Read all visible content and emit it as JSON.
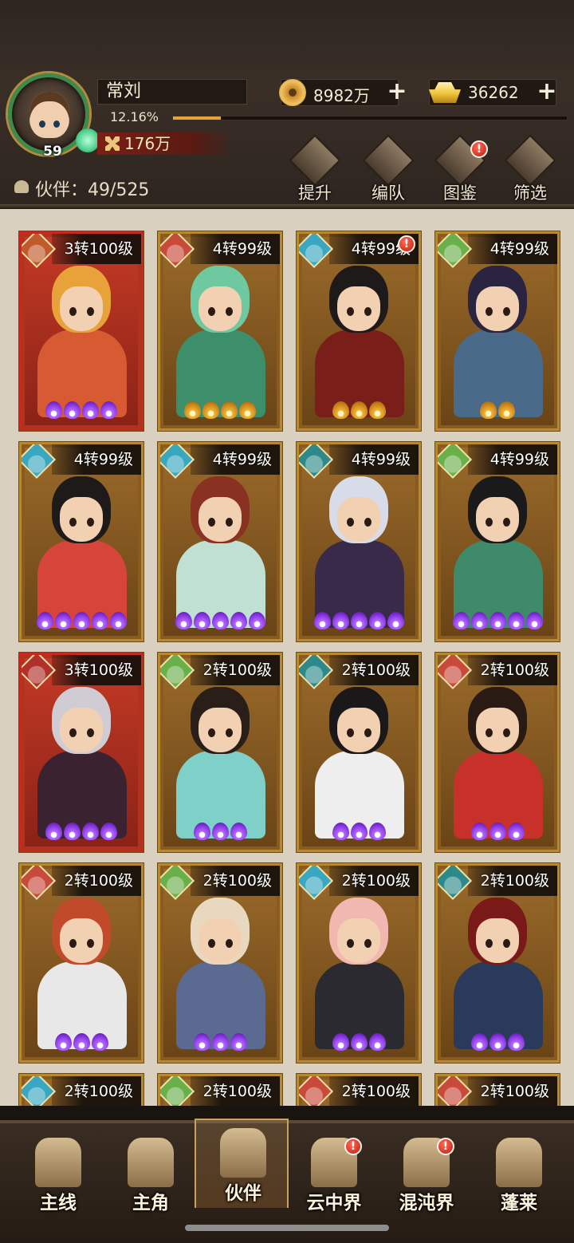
{
  "player": {
    "name": "常刘",
    "level": "59",
    "exp_percent": "12.16%",
    "exp_fraction": 0.1216,
    "power": "176万"
  },
  "currencies": {
    "coins": "8982万",
    "ingots": "36262"
  },
  "partner_count_label": "伙伴：49/525",
  "actions": [
    {
      "label": "提升",
      "icon": "upgrade-icon",
      "alert": false
    },
    {
      "label": "编队",
      "icon": "formation-icon",
      "alert": false
    },
    {
      "label": "图鉴",
      "icon": "codex-icon",
      "alert": true
    },
    {
      "label": "筛选",
      "icon": "filter-icon",
      "alert": false
    }
  ],
  "alert_mark": "!",
  "cards": [
    {
      "tag": "3转100级",
      "frame": "red",
      "element": "#c05a2a",
      "stars": 4,
      "star_color": "purple",
      "hair": "#e7a23a",
      "body": "#d85a32",
      "alert": false
    },
    {
      "tag": "4转99级",
      "frame": "gold",
      "element": "#c84a3a",
      "stars": 4,
      "star_color": "gold",
      "hair": "#6ec9a0",
      "body": "#3d8f6c",
      "alert": false
    },
    {
      "tag": "4转99级",
      "frame": "gold",
      "element": "#3aa7c0",
      "stars": 3,
      "star_color": "gold",
      "hair": "#1f1a1a",
      "body": "#7a1e1a",
      "alert": true
    },
    {
      "tag": "4转99级",
      "frame": "gold",
      "element": "#6ab04a",
      "stars": 2,
      "star_color": "gold",
      "hair": "#2a2440",
      "body": "#4a6a8a",
      "alert": false
    },
    {
      "tag": "4转99级",
      "frame": "gold",
      "element": "#3aa7c0",
      "stars": 5,
      "star_color": "purple",
      "hair": "#1e1a1a",
      "body": "#d6453a",
      "alert": false
    },
    {
      "tag": "4转99级",
      "frame": "gold",
      "element": "#3aa7c0",
      "stars": 5,
      "star_color": "purple",
      "hair": "#8a3222",
      "body": "#bfe0d2",
      "alert": false
    },
    {
      "tag": "4转99级",
      "frame": "gold",
      "element": "#2e8a8a",
      "stars": 5,
      "star_color": "purple",
      "hair": "#d8dce8",
      "body": "#3a2a4a",
      "alert": false
    },
    {
      "tag": "4转99级",
      "frame": "gold",
      "element": "#6ab04a",
      "stars": 5,
      "star_color": "purple",
      "hair": "#1a1a1a",
      "body": "#3f8a6a",
      "alert": false
    },
    {
      "tag": "3转100级",
      "frame": "red",
      "element": "#b0302a",
      "stars": 4,
      "star_color": "purple",
      "hair": "#d0ccd4",
      "body": "#3a2230",
      "alert": false
    },
    {
      "tag": "2转100级",
      "frame": "gold",
      "element": "#6ab04a",
      "stars": 3,
      "star_color": "purple",
      "hair": "#2a1e18",
      "body": "#7ed0c8",
      "alert": false
    },
    {
      "tag": "2转100级",
      "frame": "gold",
      "element": "#2e8a8a",
      "stars": 3,
      "star_color": "purple",
      "hair": "#1a1818",
      "body": "#eeeeee",
      "alert": false
    },
    {
      "tag": "2转100级",
      "frame": "gold",
      "element": "#c84a3a",
      "stars": 3,
      "star_color": "purple",
      "hair": "#2a1a14",
      "body": "#c8302a",
      "alert": false
    },
    {
      "tag": "2转100级",
      "frame": "gold",
      "element": "#c84a3a",
      "stars": 3,
      "star_color": "purple",
      "hair": "#c04a2a",
      "body": "#e8e8e8",
      "alert": false
    },
    {
      "tag": "2转100级",
      "frame": "gold",
      "element": "#6ab04a",
      "stars": 3,
      "star_color": "purple",
      "hair": "#e8d8c0",
      "body": "#5a6a90",
      "alert": false
    },
    {
      "tag": "2转100级",
      "frame": "gold",
      "element": "#3aa7c0",
      "stars": 3,
      "star_color": "purple",
      "hair": "#f0b8b0",
      "body": "#2a2a30",
      "alert": false
    },
    {
      "tag": "2转100级",
      "frame": "gold",
      "element": "#2e8a8a",
      "stars": 3,
      "star_color": "purple",
      "hair": "#7a1a18",
      "body": "#2a3a5a",
      "alert": false
    },
    {
      "tag": "2转100级",
      "frame": "gold",
      "element": "#3aa7c0",
      "stars": 0,
      "star_color": "purple",
      "hair": "#2a2a2a",
      "body": "#555",
      "alert": false
    },
    {
      "tag": "2转100级",
      "frame": "gold",
      "element": "#6ab04a",
      "stars": 0,
      "star_color": "purple",
      "hair": "#2a2a2a",
      "body": "#555",
      "alert": false
    },
    {
      "tag": "2转100级",
      "frame": "gold",
      "element": "#c84a3a",
      "stars": 0,
      "star_color": "purple",
      "hair": "#2a2a2a",
      "body": "#555",
      "alert": false
    },
    {
      "tag": "2转100级",
      "frame": "gold",
      "element": "#c84a3a",
      "stars": 0,
      "star_color": "purple",
      "hair": "#2a2a2a",
      "body": "#555",
      "alert": false
    }
  ],
  "nav": [
    {
      "label": "主线",
      "icon": "crossed-swords-icon",
      "active": false,
      "alert": false
    },
    {
      "label": "主角",
      "icon": "hero-icon",
      "active": false,
      "alert": false
    },
    {
      "label": "伙伴",
      "icon": "partner-helmet-icon",
      "active": true,
      "alert": false
    },
    {
      "label": "云中界",
      "icon": "cloud-realm-icon",
      "active": false,
      "alert": true
    },
    {
      "label": "混沌界",
      "icon": "chaos-realm-icon",
      "active": false,
      "alert": true
    },
    {
      "label": "蓬莱",
      "icon": "penglai-icon",
      "active": false,
      "alert": false
    }
  ]
}
